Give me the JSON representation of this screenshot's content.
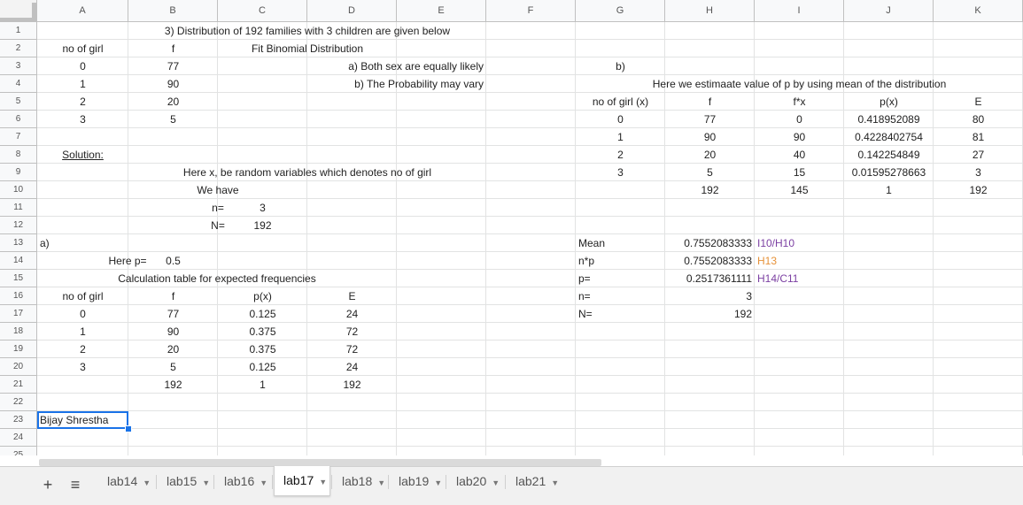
{
  "colors": {
    "formula_purple": "#7b3fa2",
    "formula_orange": "#e69138",
    "selection_blue": "#1a73e8"
  },
  "columns": [
    "A",
    "B",
    "C",
    "D",
    "E",
    "F",
    "G",
    "H",
    "I",
    "J",
    "K"
  ],
  "rows": [
    "1",
    "2",
    "3",
    "4",
    "5",
    "6",
    "7",
    "8",
    "9",
    "10",
    "11",
    "12",
    "13",
    "14",
    "15",
    "16",
    "17",
    "18",
    "19",
    "20",
    "21",
    "22",
    "23",
    "24",
    "25"
  ],
  "cells": {
    "B1": "3) Distribution of 192 families with 3 children are given below",
    "A2": "no of girl",
    "B2": "f",
    "C2": "Fit Binomial Distribution",
    "A3": "0",
    "B3": "77",
    "C3": "a) Both sex are equally likely",
    "A4": "1",
    "B4": "90",
    "C4": "b) The Probability may vary",
    "A5": "2",
    "B5": "20",
    "A6": "3",
    "B6": "5",
    "A8": "Solution:",
    "B9": "Here x, be random variables which denotes no of girl",
    "B10": "We have",
    "B11": "n=",
    "C11": "3",
    "B12": "N=",
    "C12": "192",
    "A13": "a)",
    "A14": "Here p=",
    "B14": "0.5",
    "A15": "Calculation table for expected frequencies",
    "A16": "no of girl",
    "B16": "f",
    "C16": "p(x)",
    "D16": "E",
    "A17": "0",
    "B17": "77",
    "C17": "0.125",
    "D17": "24",
    "A18": "1",
    "B18": "90",
    "C18": "0.375",
    "D18": "72",
    "A19": "2",
    "B19": "20",
    "C19": "0.375",
    "D19": "72",
    "A20": "3",
    "B20": "5",
    "C20": "0.125",
    "D20": "24",
    "B21": "192",
    "C21": "1",
    "D21": "192",
    "A23": "Bijay Shrestha",
    "G3": "b)",
    "G4": "Here we estimaate value of p by using mean of the distribution",
    "G5": "no of girl (x)",
    "H5": "f",
    "I5": "f*x",
    "J5": "p(x)",
    "K5": "E",
    "G6": "0",
    "H6": "77",
    "I6": "0",
    "J6": "0.418952089",
    "K6": "80",
    "G7": "1",
    "H7": "90",
    "I7": "90",
    "J7": "0.4228402754",
    "K7": "81",
    "G8": "2",
    "H8": "20",
    "I8": "40",
    "J8": "0.142254849",
    "K8": "27",
    "G9": "3",
    "H9": "5",
    "I9": "15",
    "J9": "0.01595278663",
    "K9": "3",
    "H10": "192",
    "I10": "145",
    "J10": "1",
    "K10": "192",
    "G13": "Mean",
    "H13": "0.7552083333",
    "I13": "I10/H10",
    "G14": "n*p",
    "H14": "0.7552083333",
    "I14": "H13",
    "G15": "p=",
    "H15": "0.2517361111",
    "I15": "H14/C11",
    "G16": "n=",
    "H16": "3",
    "G17": "N=",
    "H17": "192"
  },
  "sheet_tabs": [
    "lab14",
    "lab15",
    "lab16",
    "lab17",
    "lab18",
    "lab19",
    "lab20",
    "lab21"
  ],
  "active_tab": "lab17",
  "toolbar": {
    "add_sheet": "+",
    "all_sheets": "≡"
  }
}
